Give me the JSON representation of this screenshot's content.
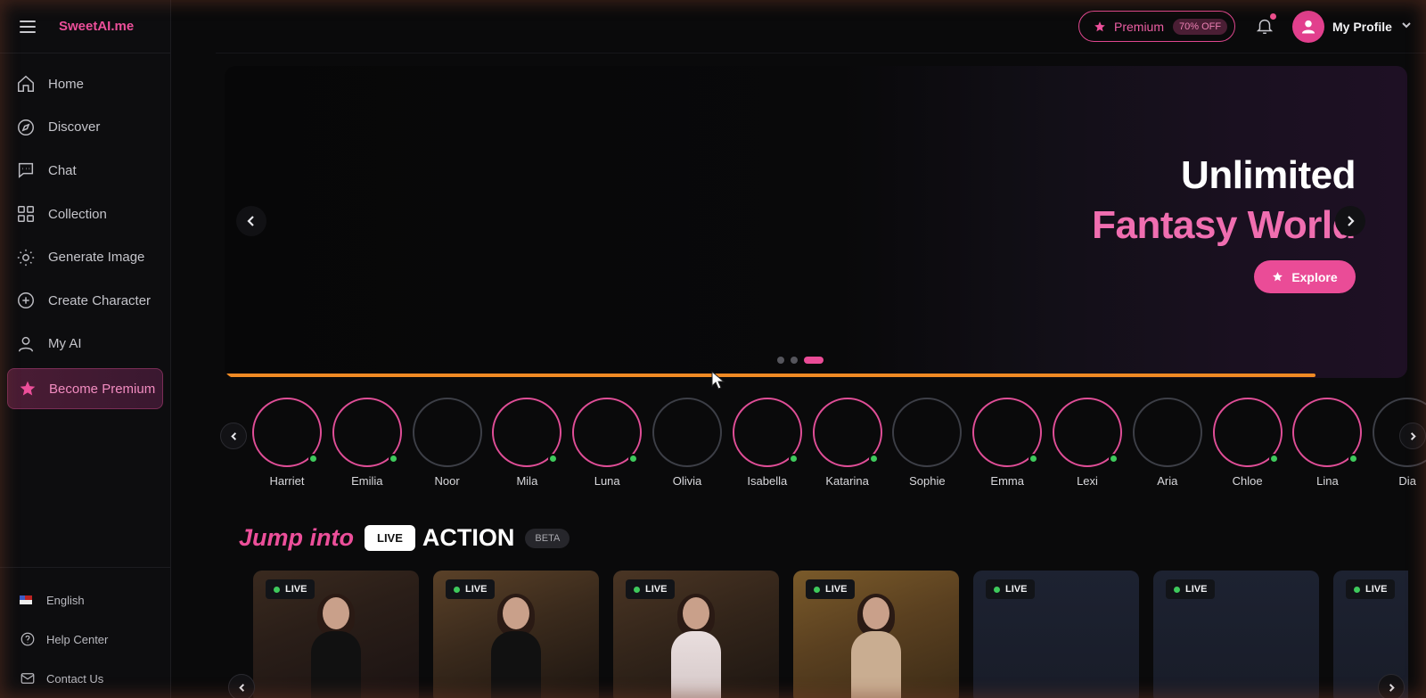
{
  "brand": "SweetAI.me",
  "nav": [
    {
      "label": "Home",
      "icon": "home-icon"
    },
    {
      "label": "Discover",
      "icon": "compass-icon"
    },
    {
      "label": "Chat",
      "icon": "chat-icon"
    },
    {
      "label": "Collection",
      "icon": "grid-icon"
    },
    {
      "label": "Generate Image",
      "icon": "sparkle-icon"
    },
    {
      "label": "Create Character",
      "icon": "plus-circle-icon"
    },
    {
      "label": "My AI",
      "icon": "user-icon"
    }
  ],
  "become_premium": "Become Premium",
  "footer": {
    "language": "English",
    "help": "Help Center",
    "contact": "Contact Us"
  },
  "topbar": {
    "premium_label": "Premium",
    "premium_badge": "70% OFF",
    "profile_name": "My Profile"
  },
  "hero": {
    "title_line1": "Unlimited",
    "title_line2": "Fantasy World",
    "button": "Explore",
    "slides": 3,
    "active_slide": 3,
    "progress_fraction": 0.92
  },
  "characters": [
    {
      "name": "Harriet",
      "online": true
    },
    {
      "name": "Emilia",
      "online": true
    },
    {
      "name": "Noor",
      "online": false
    },
    {
      "name": "Mila",
      "online": true
    },
    {
      "name": "Luna",
      "online": true
    },
    {
      "name": "Olivia",
      "online": false
    },
    {
      "name": "Isabella",
      "online": true
    },
    {
      "name": "Katarina",
      "online": true
    },
    {
      "name": "Sophie",
      "online": false
    },
    {
      "name": "Emma",
      "online": true
    },
    {
      "name": "Lexi",
      "online": true
    },
    {
      "name": "Aria",
      "online": false
    },
    {
      "name": "Chloe",
      "online": true
    },
    {
      "name": "Lina",
      "online": true
    },
    {
      "name": "Dia",
      "online": false
    }
  ],
  "live_section": {
    "title_italic": "Jump into",
    "live_tag": "LIVE",
    "title_bold": "ACTION",
    "beta": "BETA",
    "card_badge": "LIVE",
    "card_count": 7
  },
  "colors": {
    "accent": "#ec4f9a",
    "online": "#3ec95c",
    "progress": "#f08a24"
  }
}
